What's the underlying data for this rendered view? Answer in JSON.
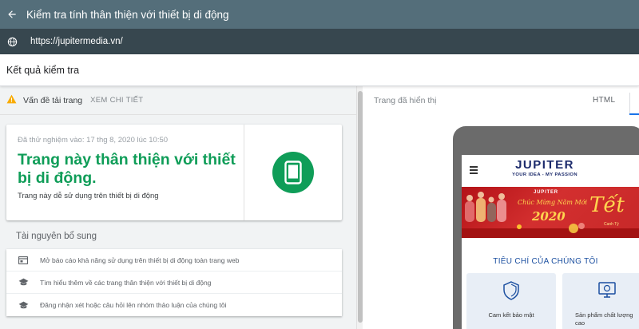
{
  "header": {
    "title": "Kiểm tra tính thân thiện với thiết bị di động"
  },
  "url_bar": {
    "url": "https://jupitermedia.vn/"
  },
  "results": {
    "title": "Kết quả kiểm tra"
  },
  "warning": {
    "label": "Vấn đề tải trang",
    "details_link": "XEM CHI TIẾT"
  },
  "result_card": {
    "tested_at": "Đã thử nghiệm vào: 17 thg 8, 2020 lúc 10:50",
    "headline": "Trang này thân thiện với thiết bị di động.",
    "subtext": "Trang này dễ sử dụng trên thiết bị di động"
  },
  "resources": {
    "title": "Tài nguyên bổ sung",
    "items": [
      {
        "icon": "report-icon",
        "label": "Mở báo cáo khả năng sử dụng trên thiết bị di động toàn trang web"
      },
      {
        "icon": "school-icon",
        "label": "Tìm hiểu thêm về các trang thân thiện với thiết bị di động"
      },
      {
        "icon": "school-icon",
        "label": "Đăng nhận xét hoặc câu hỏi lên nhóm thảo luận của chúng tôi"
      }
    ]
  },
  "preview": {
    "rendered_label": "Trang đã hiển thị",
    "html_tab": "HTML",
    "site": {
      "brand": "JUPITER",
      "tagline": "YOUR IDEA - MY PASSION",
      "banner_logo": "JUPITER",
      "banner_greeting": "Chúc Mừng Năm Mới",
      "banner_year": "2020",
      "banner_tet": "Tết",
      "banner_sub": "Canh Tý",
      "section_title": "TIÊU CHÍ CỦA CHÚNG TÔI",
      "features": [
        {
          "label": "Cam kết bảo mật"
        },
        {
          "label": "Sản phẩm chất lượng cao"
        }
      ]
    }
  },
  "colors": {
    "top_bar": "#546e7a",
    "url_bar": "#37474f",
    "success_green": "#0f9d58",
    "warning_yellow": "#f9ab00"
  }
}
